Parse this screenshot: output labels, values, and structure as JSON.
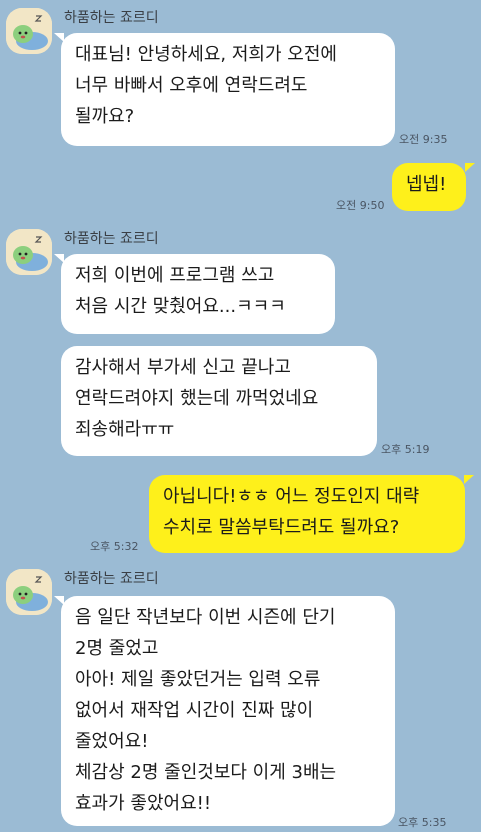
{
  "colors": {
    "background": "#9bbbd4",
    "incoming_bubble": "#ffffff",
    "outgoing_bubble": "#fef01b"
  },
  "messages": [
    {
      "sender": "하품하는 죠르디",
      "lines": [
        "대표님! 안녕하세요, 저희가 오전에",
        "너무 바빠서 오후에 연락드려도",
        "될까요?"
      ],
      "time": "오전 9:35"
    },
    {
      "lines": [
        "넵넵!"
      ],
      "time": "오전 9:50"
    },
    {
      "sender": "하품하는 죠르디",
      "lines": [
        "저희 이번에 프로그램 쓰고",
        "처음 시간 맞췄어요...ㅋㅋㅋ"
      ]
    },
    {
      "lines": [
        "감사해서 부가세 신고 끝나고",
        "연락드려야지 했는데 까먹었네요",
        "죄송해라ㅠㅠ"
      ],
      "time": "오후 5:19"
    },
    {
      "lines": [
        "아닙니다!ㅎㅎ 어느 정도인지 대략",
        "수치로 말씀부탁드려도 될까요?"
      ],
      "time": "오후 5:32"
    },
    {
      "sender": "하품하는 죠르디",
      "lines": [
        "음 일단 작년보다 이번 시즌에 단기",
        "2명 줄었고",
        "아아! 제일 좋았던거는 입력 오류",
        "없어서 재작업 시간이 진짜 많이",
        "줄었어요!",
        "체감상 2명 줄인것보다 이게 3배는",
        "효과가 좋았어요!!"
      ],
      "time": "오후 5:35"
    }
  ]
}
